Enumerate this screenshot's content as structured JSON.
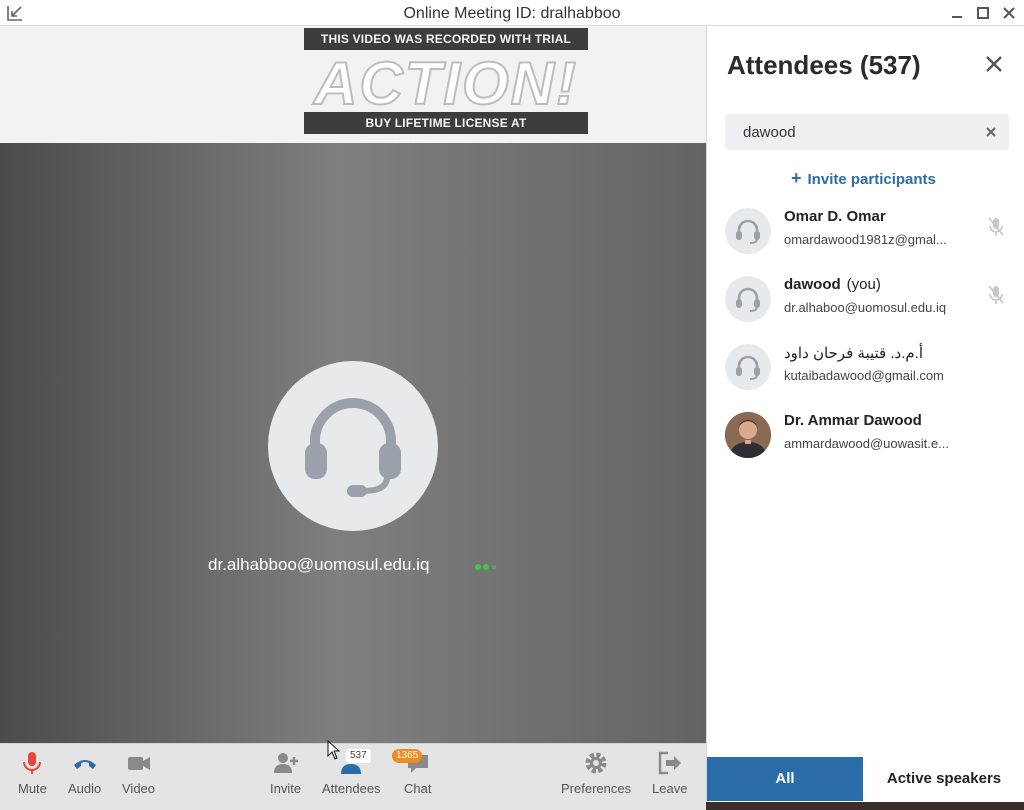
{
  "window": {
    "title": "Online Meeting ID: dralhabboo"
  },
  "watermark": {
    "top_text": "THIS VIDEO WAS RECORDED WITH TRIAL VERSION",
    "logo_text": "ACTION!",
    "bottom_text": "BUY LIFETIME LICENSE AT WWW.MIRILLIS.COM"
  },
  "video": {
    "participant_name": "dr.alhabboo@uomosul.edu.iq"
  },
  "toolbar": {
    "mute": "Mute",
    "audio": "Audio",
    "video": "Video",
    "invite": "Invite",
    "attendees": "Attendees",
    "attendees_badge": "537",
    "chat": "Chat",
    "chat_badge": "1365",
    "preferences": "Preferences",
    "leave": "Leave"
  },
  "colors": {
    "accent": "#2a6da8",
    "mute_red": "#e5463b",
    "audio_blue": "#2a6da8",
    "chat_badge": "#f28b1e",
    "signal_green": "#48c24a"
  },
  "panel": {
    "title": "Attendees (537)",
    "search_value": "dawood",
    "invite_label": "Invite participants",
    "attendees": [
      {
        "name": "Omar D. Omar",
        "suffix": "",
        "email": "omardawood1981z@gmal..."
      },
      {
        "name": "dawood",
        "suffix": "(you)",
        "email": "dr.alhaboo@uomosul.edu.iq"
      },
      {
        "name": "أ.م.د. قتيبة فرحان داود",
        "suffix": "",
        "email": "kutaibadawood@gmail.com"
      },
      {
        "name": "Dr. Ammar Dawood",
        "suffix": "",
        "email": "ammardawood@uowasit.e..."
      }
    ],
    "tabs": {
      "all": "All",
      "active_speakers": "Active speakers"
    }
  }
}
